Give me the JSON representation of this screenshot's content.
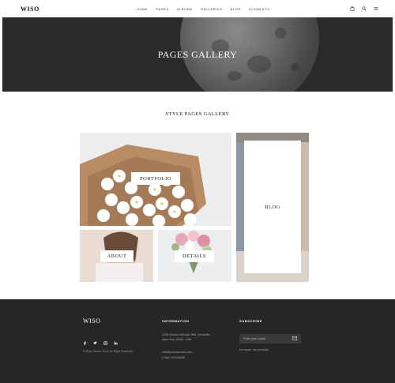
{
  "header": {
    "logo": "WISO",
    "nav": [
      "HOME",
      "PAGES",
      "ALBUMS",
      "GALLERIES",
      "BLOG",
      "ELEMENTS"
    ],
    "icons": [
      "bag-icon",
      "search-icon",
      "menu-icon"
    ]
  },
  "hero": {
    "title": "PAGES GALLERY"
  },
  "section": {
    "title": "STYLE PAGES GALLERY"
  },
  "gallery": {
    "portfolio": "PORTFOLIO",
    "about": "ABOUT",
    "details": "DETAILS",
    "blog": "BLOG"
  },
  "footer": {
    "logo": "WISO",
    "social": [
      "facebook-icon",
      "twitter-icon",
      "instagram-icon",
      "linkedin-icon"
    ],
    "copyright": "© Wiso Studio 2018. All Right Reserved.",
    "information_heading": "INFORMATION",
    "address_line1": "2005 Stokes Isle Apt. 896, Venaville,",
    "address_line2": "New York 10010, USA",
    "email": "info@yourdomain.com",
    "phone": "(+68) 120034509",
    "subscribe_heading": "SUBSCRIBE",
    "email_placeholder": "Enter your email",
    "no_spam": "No spam, we promise"
  }
}
